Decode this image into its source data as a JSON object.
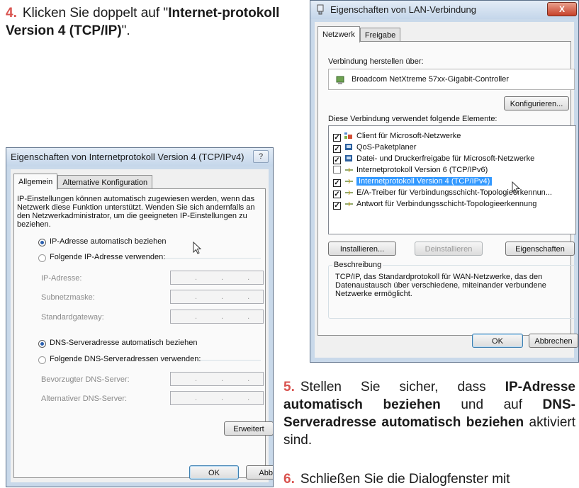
{
  "steps": {
    "step4_num": "4.",
    "step4_pre": "Klicken Sie doppelt auf  \"",
    "step4_bold": "Internet-protokoll Version 4 (TCP/IP)",
    "step4_post": "\".",
    "step5_num": "5.",
    "step5_a": "Stellen Sie sicher, dass ",
    "step5_b": "IP-Adresse automatisch beziehen",
    "step5_c": " und auf ",
    "step5_d": "DNS-Serveradresse automatisch beziehen",
    "step5_e": " aktiviert sind.",
    "step6_num": "6.",
    "step6_text": "Schließen Sie die Dialogfenster mit"
  },
  "ipv4_dialog": {
    "title": "Eigenschaften von Internetprotokoll Version 4 (TCP/IPv4)",
    "help_label": "?",
    "tabs": [
      "Allgemein",
      "Alternative Konfiguration"
    ],
    "intro": [
      "IP-Einstellungen können automatisch zugewiesen werden, wenn das",
      "Netzwerk diese Funktion unterstützt. Wenden Sie sich andernfalls an",
      "den Netzwerkadministrator, um die geeigneten IP-Einstellungen zu",
      "beziehen."
    ],
    "radio_ip_auto": "IP-Adresse automatisch beziehen",
    "radio_ip_manual": "Folgende IP-Adresse verwenden:",
    "field_ip": "IP-Adresse:",
    "field_subnet": "Subnetzmaske:",
    "field_gateway": "Standardgateway:",
    "radio_dns_auto": "DNS-Serveradresse automatisch beziehen",
    "radio_dns_manual": "Folgende DNS-Serveradressen verwenden:",
    "field_dns_pref": "Bevorzugter DNS-Server:",
    "field_dns_alt": "Alternativer DNS-Server:",
    "ip_dots": "...",
    "advanced_button": "Erweitert",
    "ok_button": "OK",
    "cancel_button": "Abbr"
  },
  "lan_dialog": {
    "title": "Eigenschaften von LAN-Verbindung",
    "close_label": "X",
    "tabs": [
      "Netzwerk",
      "Freigabe"
    ],
    "connect_via_label": "Verbindung herstellen über:",
    "adapter": "Broadcom NetXtreme 57xx-Gigabit-Controller",
    "configure_button": "Konfigurieren...",
    "elements_label": "Diese Verbindung verwendet folgende Elemente:",
    "items": [
      {
        "label": "Client für Microsoft-Netzwerke",
        "checked": "✓"
      },
      {
        "label": "QoS-Paketplaner",
        "checked": "✓"
      },
      {
        "label": "Datei- und Druckerfreigabe für Microsoft-Netzwerke",
        "checked": "✓"
      },
      {
        "label": "Internetprotokoll Version 6 (TCP/IPv6)",
        "checked": ""
      },
      {
        "label": "Internetprotokoll Version 4 (TCP/IPv4)",
        "checked": "✓"
      },
      {
        "label": "E/A-Treiber für Verbindungsschicht-Topologieerkennun...",
        "checked": "✓"
      },
      {
        "label": "Antwort für Verbindungsschicht-Topologieerkennung",
        "checked": "✓"
      }
    ],
    "install_button": "Installieren...",
    "uninstall_button": "Deinstallieren",
    "properties_button": "Eigenschaften",
    "description_label": "Beschreibung",
    "description": [
      "TCP/IP, das Standardprotokoll für WAN-Netzwerke, das den",
      "Datenaustausch über verschiedene, miteinander verbundene",
      "Netzwerke ermöglicht."
    ],
    "ok_button": "OK",
    "cancel_button": "Abbrechen"
  },
  "colors": {
    "step_number": "#d9534f",
    "selection": "#3399ff",
    "dialog_frame": "#c9d9ea"
  }
}
